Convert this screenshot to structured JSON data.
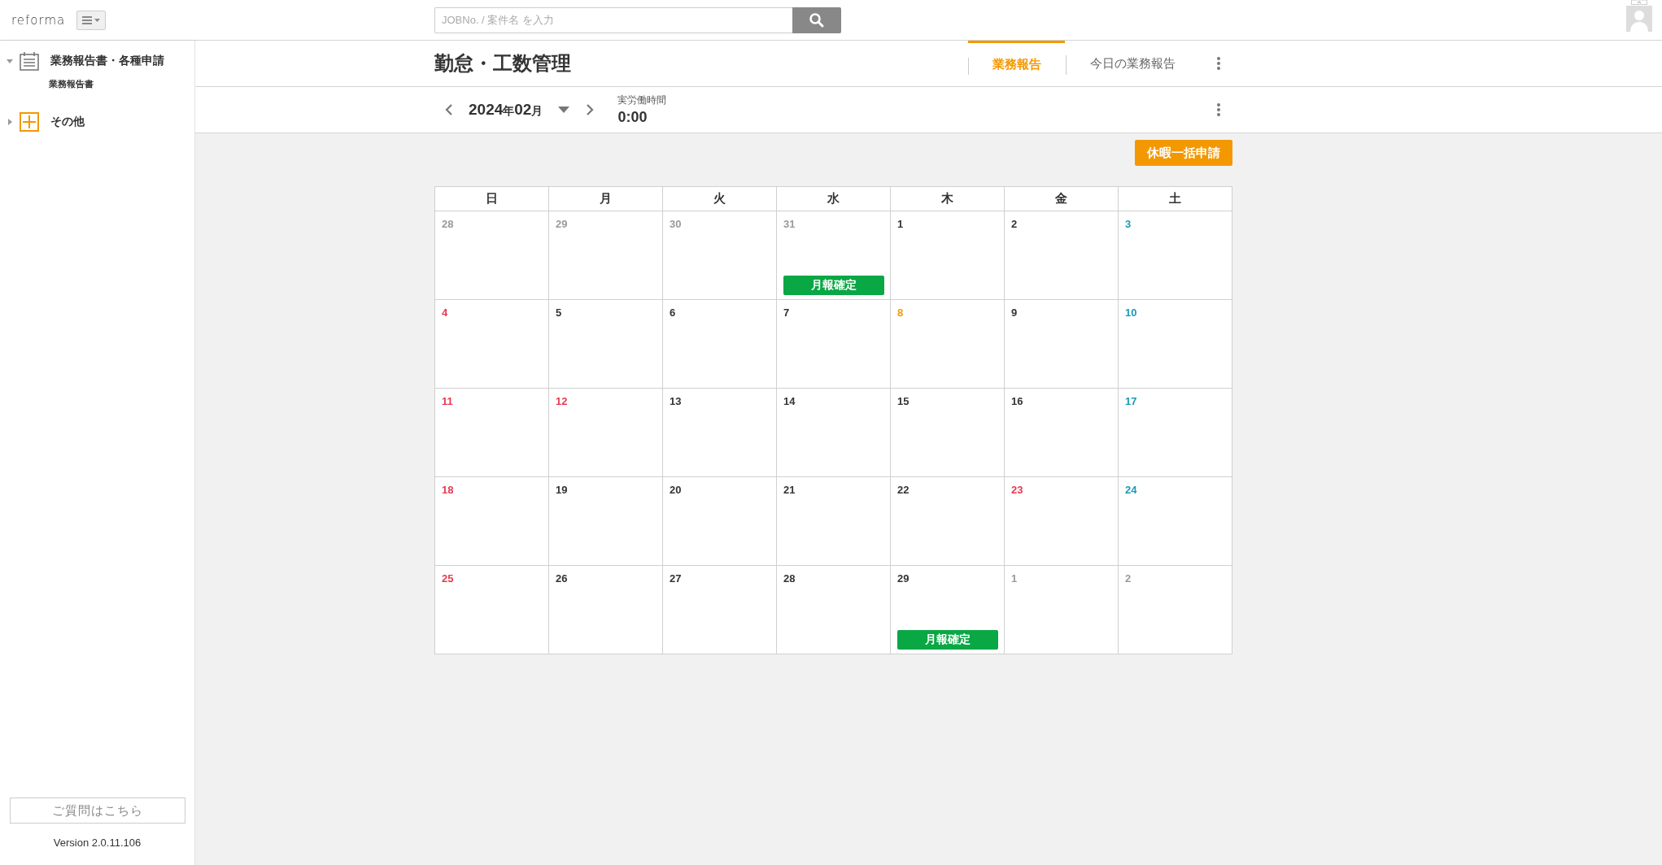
{
  "header": {
    "logo": "reforma",
    "search": {
      "placeholder": "JOBNo. / 案件名 を入力"
    }
  },
  "sidebar": {
    "items": [
      {
        "label": "業務報告書・各種申請",
        "expanded": true,
        "children": [
          {
            "label": "業務報告書"
          }
        ]
      },
      {
        "label": "その他",
        "expanded": false
      }
    ],
    "help_button": "ご質問はこちら",
    "version": "Version 2.0.11.106"
  },
  "page": {
    "title": "勤怠・工数管理",
    "tabs": [
      {
        "label": "業務報告",
        "selected": true
      },
      {
        "label": "今日の業務報告",
        "selected": false
      }
    ]
  },
  "toolbar": {
    "month_year": "2024",
    "year_suffix": "年",
    "month": "02",
    "month_suffix": "月",
    "work_time_label": "実労働時間",
    "work_time": "0:00"
  },
  "bulk_leave_button": "休暇一括申請",
  "calendar": {
    "weekdays": [
      "日",
      "月",
      "火",
      "水",
      "木",
      "金",
      "土"
    ],
    "days": [
      {
        "day": "28",
        "kind": "outside"
      },
      {
        "day": "29",
        "kind": "outside"
      },
      {
        "day": "30",
        "kind": "outside"
      },
      {
        "day": "31",
        "kind": "outside",
        "badge": "月報確定"
      },
      {
        "day": "1",
        "kind": "weekday"
      },
      {
        "day": "2",
        "kind": "weekday"
      },
      {
        "day": "3",
        "kind": "saturday"
      },
      {
        "day": "4",
        "kind": "holiday"
      },
      {
        "day": "5",
        "kind": "weekday"
      },
      {
        "day": "6",
        "kind": "weekday"
      },
      {
        "day": "7",
        "kind": "weekday"
      },
      {
        "day": "8",
        "kind": "today"
      },
      {
        "day": "9",
        "kind": "weekday"
      },
      {
        "day": "10",
        "kind": "saturday"
      },
      {
        "day": "11",
        "kind": "holiday"
      },
      {
        "day": "12",
        "kind": "holiday"
      },
      {
        "day": "13",
        "kind": "weekday"
      },
      {
        "day": "14",
        "kind": "weekday"
      },
      {
        "day": "15",
        "kind": "weekday"
      },
      {
        "day": "16",
        "kind": "weekday"
      },
      {
        "day": "17",
        "kind": "saturday"
      },
      {
        "day": "18",
        "kind": "holiday"
      },
      {
        "day": "19",
        "kind": "weekday"
      },
      {
        "day": "20",
        "kind": "weekday"
      },
      {
        "day": "21",
        "kind": "weekday"
      },
      {
        "day": "22",
        "kind": "weekday"
      },
      {
        "day": "23",
        "kind": "holiday"
      },
      {
        "day": "24",
        "kind": "saturday"
      },
      {
        "day": "25",
        "kind": "holiday"
      },
      {
        "day": "26",
        "kind": "weekday"
      },
      {
        "day": "27",
        "kind": "weekday"
      },
      {
        "day": "28",
        "kind": "weekday"
      },
      {
        "day": "29",
        "kind": "weekday",
        "badge": "月報確定"
      },
      {
        "day": "1",
        "kind": "outside"
      },
      {
        "day": "2",
        "kind": "outside"
      }
    ]
  }
}
